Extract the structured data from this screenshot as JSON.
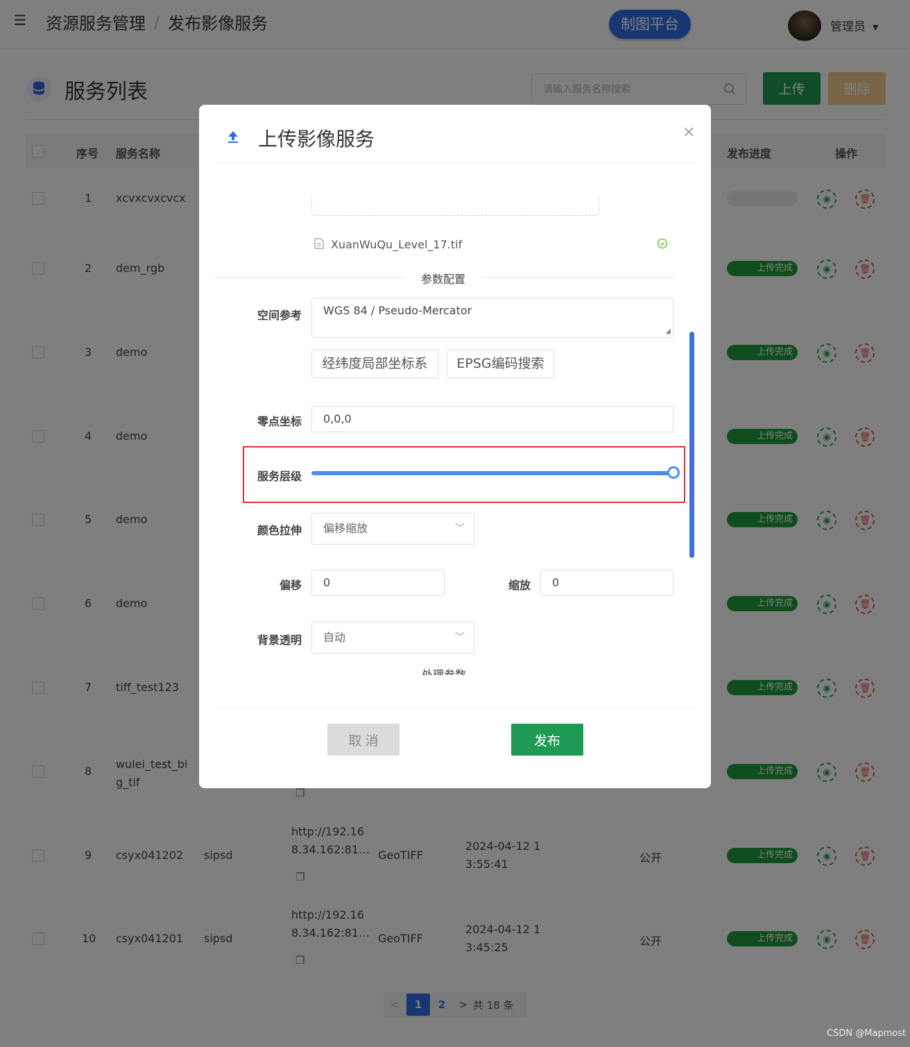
{
  "header": {
    "breadcrumb": [
      "资源服务管理",
      "发布影像服务"
    ],
    "separator": "/",
    "platform_button": "制图平台",
    "user": "管理员"
  },
  "list": {
    "title": "服务列表",
    "search_placeholder": "请输入服务名称搜索",
    "upload_label": "上传",
    "delete_label": "删除",
    "columns": {
      "index": "序号",
      "name": "服务名称",
      "progress": "发布进度",
      "actions": "操作"
    },
    "rows": [
      {
        "index": "1",
        "name": "xcvxcvxcvcx",
        "status": ""
      },
      {
        "index": "2",
        "name": "dem_rgb",
        "status": "上传完成"
      },
      {
        "index": "3",
        "name": "demo",
        "status": "上传完成"
      },
      {
        "index": "4",
        "name": "demo",
        "status": "上传完成"
      },
      {
        "index": "5",
        "name": "demo",
        "status": "上传完成"
      },
      {
        "index": "6",
        "name": "demo",
        "status": "上传完成"
      },
      {
        "index": "7",
        "name": "tiff_test123",
        "status": "上传完成"
      },
      {
        "index": "8",
        "name": "wulei_test_big_tif",
        "status": "上传完成"
      },
      {
        "index": "9",
        "name": "csyx041202",
        "owner": "sipsd",
        "url_line1": "http://192.16",
        "url_line2": "8.34.162:81…",
        "format": "GeoTIFF",
        "time_line1": "2024-04-12 1",
        "time_line2": "3:55:41",
        "access": "公开",
        "status": "上传完成"
      },
      {
        "index": "10",
        "name": "csyx041201",
        "owner": "sipsd",
        "url_line1": "http://192.16",
        "url_line2": "8.34.162:81…",
        "format": "GeoTIFF",
        "time_line1": "2024-04-12 1",
        "time_line2": "3:45:25",
        "access": "公开",
        "status": "上传完成"
      }
    ],
    "pagination": {
      "prev": "<",
      "pages": [
        "1",
        "2"
      ],
      "current": "1",
      "next": ">",
      "total": "共 18 条"
    }
  },
  "dialog": {
    "title": "上传影像服务",
    "file_name": "XuanWuQu_Level_17.tif",
    "section_label": "参数配置",
    "spatial_ref_label": "空间参考",
    "spatial_ref_value": "WGS 84 / Pseudo-Mercator",
    "latlon_button": "经纬度局部坐标系",
    "epsg_button": "EPSG编码搜索",
    "origin_label": "零点坐标",
    "origin_value": "0,0,0",
    "service_level_label": "服务层级",
    "service_level_fraction": 1.0,
    "color_stretch_label": "颜色拉伸",
    "color_stretch_value": "偏移缩放",
    "offset_label": "偏移",
    "offset_value": "0",
    "scale_label": "缩放",
    "scale_value": "0",
    "bg_transparent_label": "背景透明",
    "bg_transparent_value": "自动",
    "next_section_label": "处理参数",
    "cancel_label": "取 消",
    "publish_label": "发布"
  },
  "watermark": "CSDN @Mapmost",
  "colors": {
    "primary": "#2f6fe6",
    "success": "#1f9a55",
    "danger": "#e03131",
    "slider": "#4a8ef5"
  }
}
